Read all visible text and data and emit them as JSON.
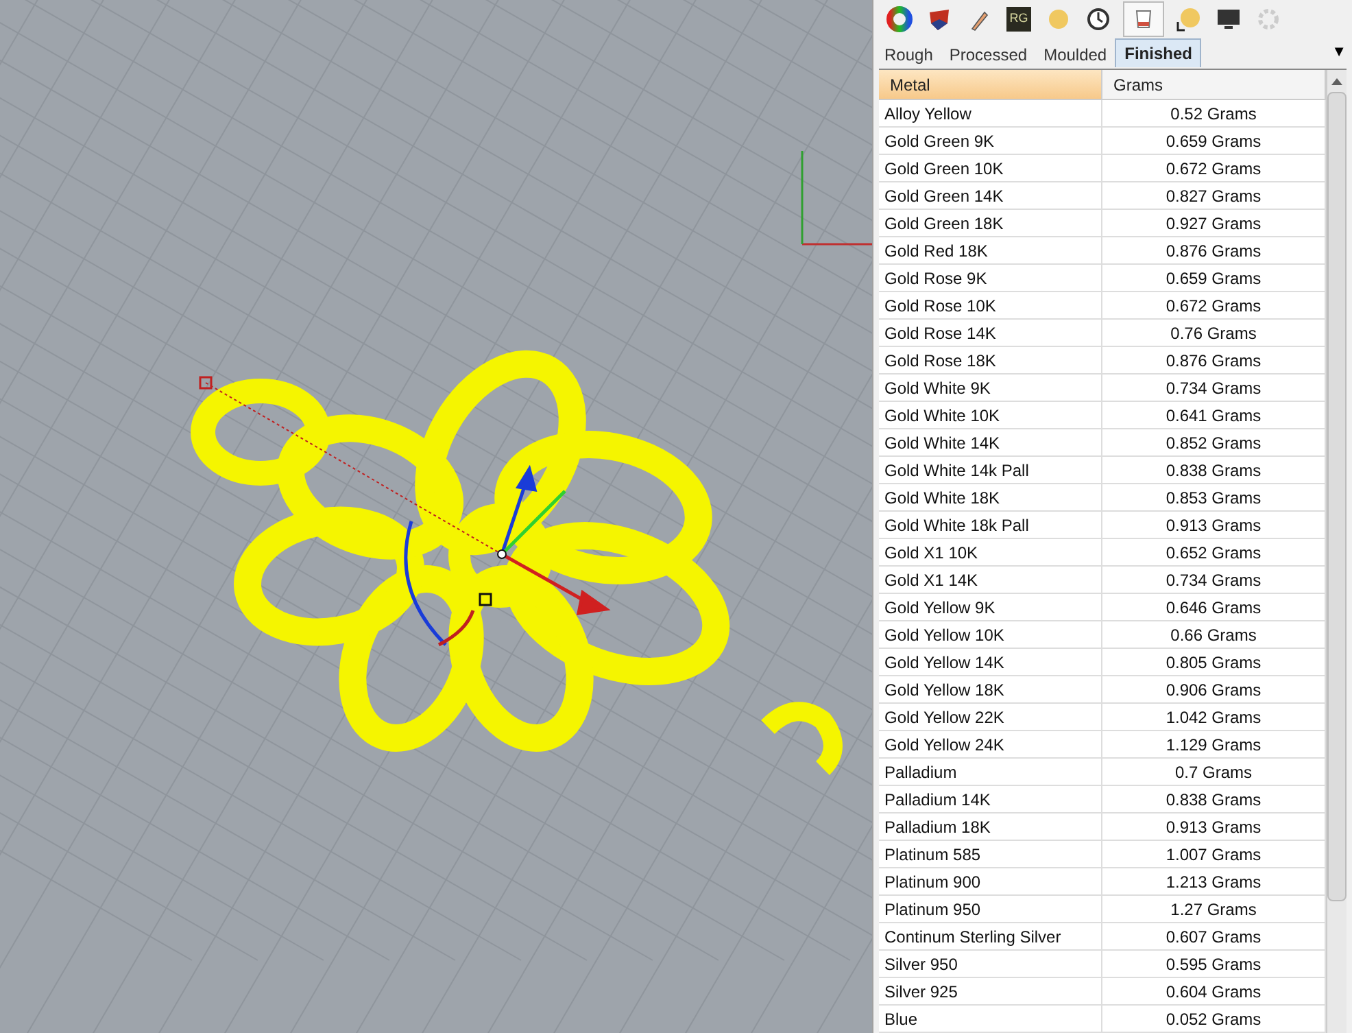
{
  "toolbar": [
    {
      "kind": "color-wheel",
      "selected": false
    },
    {
      "kind": "material",
      "selected": false
    },
    {
      "kind": "brush",
      "selected": false
    },
    {
      "kind": "rg",
      "label": "RG",
      "selected": false
    },
    {
      "kind": "sun",
      "selected": false
    },
    {
      "kind": "clock",
      "selected": false
    },
    {
      "kind": "crucible",
      "selected": true
    },
    {
      "kind": "light",
      "selected": false
    },
    {
      "kind": "monitor",
      "selected": false
    },
    {
      "kind": "gear",
      "selected": false
    }
  ],
  "tabs": [
    {
      "label": "Rough",
      "selected": false
    },
    {
      "label": "Processed",
      "selected": false
    },
    {
      "label": "Moulded",
      "selected": false
    },
    {
      "label": "Finished",
      "selected": true
    }
  ],
  "tab_menu": "▼",
  "table": {
    "columns": [
      {
        "label": "Metal",
        "sorted": true
      },
      {
        "label": "Grams",
        "sorted": false
      }
    ],
    "rows": [
      [
        "Alloy Yellow",
        "0.52 Grams"
      ],
      [
        "Gold Green 9K",
        "0.659 Grams"
      ],
      [
        "Gold Green 10K",
        "0.672 Grams"
      ],
      [
        "Gold Green 14K",
        "0.827 Grams"
      ],
      [
        "Gold Green 18K",
        "0.927 Grams"
      ],
      [
        "Gold Red 18K",
        "0.876 Grams"
      ],
      [
        "Gold Rose 9K",
        "0.659 Grams"
      ],
      [
        "Gold Rose 10K",
        "0.672 Grams"
      ],
      [
        "Gold Rose 14K",
        "0.76 Grams"
      ],
      [
        "Gold Rose 18K",
        "0.876 Grams"
      ],
      [
        "Gold White 9K",
        "0.734 Grams"
      ],
      [
        "Gold White 10K",
        "0.641 Grams"
      ],
      [
        "Gold White 14K",
        "0.852 Grams"
      ],
      [
        "Gold White 14k Pall",
        "0.838 Grams"
      ],
      [
        "Gold White 18K",
        "0.853 Grams"
      ],
      [
        "Gold White 18k Pall",
        "0.913 Grams"
      ],
      [
        "Gold X1 10K",
        "0.652 Grams"
      ],
      [
        "Gold X1 14K",
        "0.734 Grams"
      ],
      [
        "Gold Yellow 9K",
        "0.646 Grams"
      ],
      [
        "Gold Yellow 10K",
        "0.66 Grams"
      ],
      [
        "Gold Yellow 14K",
        "0.805 Grams"
      ],
      [
        "Gold Yellow 18K",
        "0.906 Grams"
      ],
      [
        "Gold Yellow 22K",
        "1.042 Grams"
      ],
      [
        "Gold Yellow 24K",
        "1.129 Grams"
      ],
      [
        "Palladium",
        "0.7 Grams"
      ],
      [
        "Palladium 14K",
        "0.838 Grams"
      ],
      [
        "Palladium 18K",
        "0.913 Grams"
      ],
      [
        "Platinum 585",
        "1.007 Grams"
      ],
      [
        "Platinum 900",
        "1.213 Grams"
      ],
      [
        "Platinum 950",
        "1.27 Grams"
      ],
      [
        "Continum Sterling Silver",
        "0.607 Grams"
      ],
      [
        "Silver 950",
        "0.595 Grams"
      ],
      [
        "Silver 925",
        "0.604 Grams"
      ],
      [
        "Blue",
        "0.052 Grams"
      ]
    ]
  }
}
